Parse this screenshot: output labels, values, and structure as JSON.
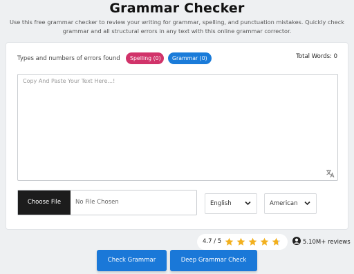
{
  "header": {
    "title": "Grammar Checker",
    "description": "Use this free grammar checker to review your writing for grammar, spelling, and punctuation mistakes. Quickly check grammar and all structural errors in any text with this online grammar corrector."
  },
  "errors": {
    "label": "Types and numbers of errors found",
    "spelling_label": "Spelling (0)",
    "grammar_label": "Grammar (0)"
  },
  "total_words": "Total Words: 0",
  "editor": {
    "placeholder": "Copy And Paste Your Text Here...!"
  },
  "file": {
    "choose_label": "Choose File",
    "status": "No File Chosen"
  },
  "language_select": {
    "value": "English"
  },
  "variant_select": {
    "value": "American"
  },
  "rating": {
    "score": "4.7 / 5",
    "stars_value": 4.7,
    "stars_max": 5
  },
  "reviews": "5.10M+ reviews",
  "actions": {
    "check_label": "Check Grammar",
    "deep_label": "Deep Grammar Check"
  },
  "colors": {
    "primary": "#1a78d8",
    "spelling": "#d1336a",
    "grammar": "#1a7bd9",
    "star": "#f2b01e"
  },
  "icons": {
    "resize": "translate-icon",
    "chevron": "chevron-down-icon",
    "user": "user-icon",
    "star": "star-icon"
  }
}
